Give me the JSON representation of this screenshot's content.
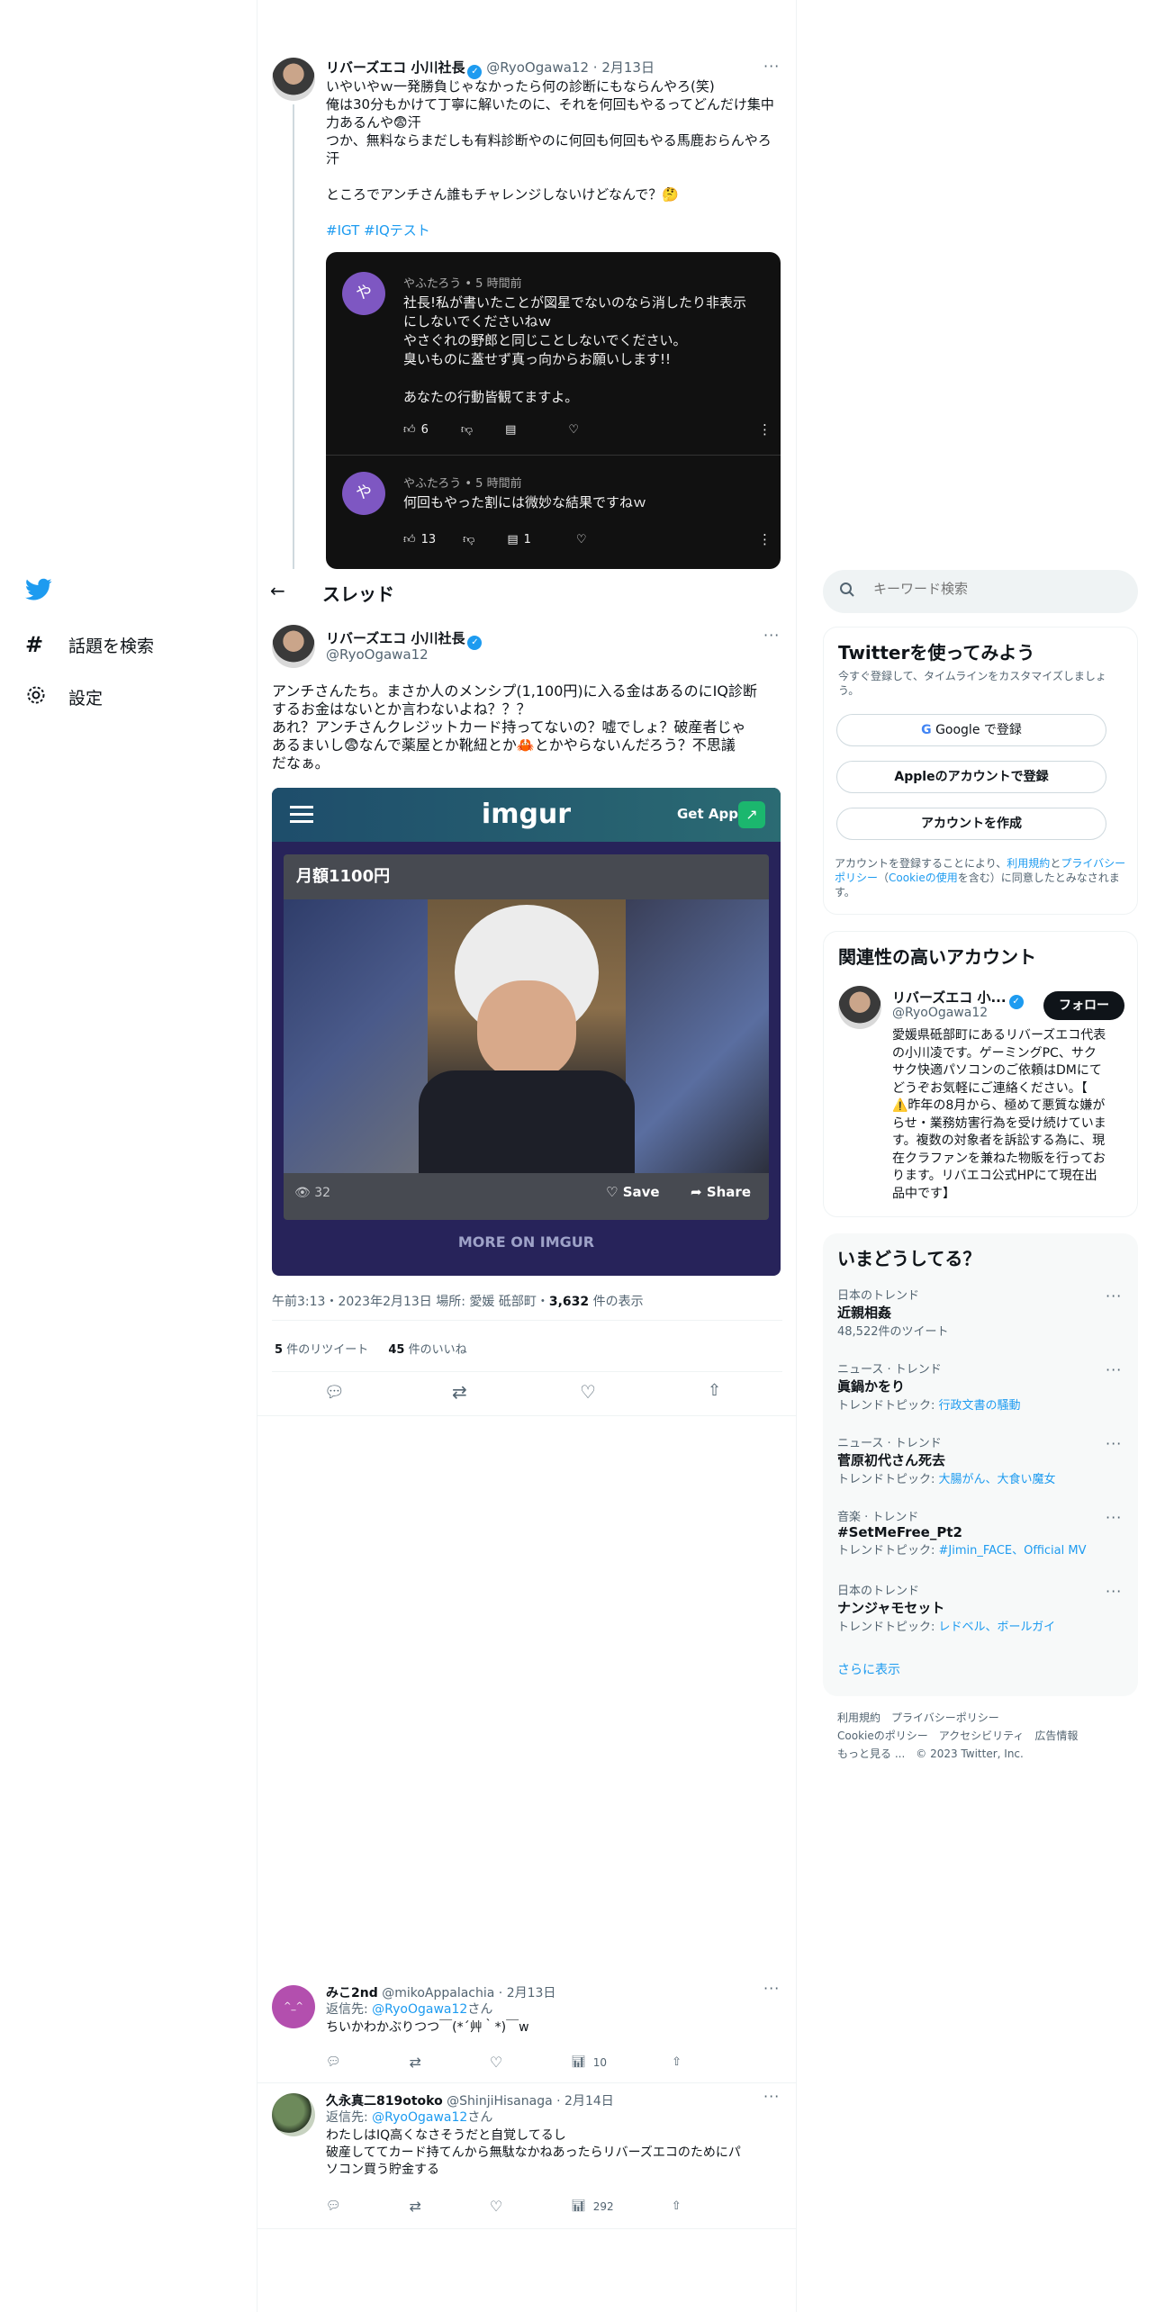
{
  "left_nav": {
    "items": [
      {
        "label": "話題を検索"
      },
      {
        "label": "設定"
      }
    ]
  },
  "quoted_tweet": {
    "name": "リバーズエコ 小川社長",
    "handle": "@RyoOgawa12",
    "date": "2月13日",
    "lines": [
      "いやいやｗ一発勝負じゃなかったら何の診断にもならんやろ(笑)",
      "俺は30分もかけて丁寧に解いたのに、それを何回もやるってどんだけ集中",
      "力あるんや😨汗",
      "つか、無料ならまだしも有料診断やのに何回も何回もやる馬鹿おらんやろ",
      "汗",
      "",
      "ところでアンチさん誰もチャレンジしないけどなんで？🤔"
    ],
    "hashtags": "#IGT #IQテスト",
    "embedded_comments": [
      {
        "avatar_char": "や",
        "author": "やふたろう",
        "time": "5 時間前",
        "lines": [
          "社長!私が書いたことが図星でないのなら消したり非表示",
          "にしないでくださいねｗ",
          "やさぐれの野郎と同じことしないでください。",
          "臭いものに蓋せず真っ向からお願いします!!",
          "",
          "あなたの行動皆観てますよ。"
        ],
        "likes": "6",
        "replies": ""
      },
      {
        "avatar_char": "や",
        "author": "やふたろう",
        "time": "5 時間前",
        "lines": [
          "何回もやった割には微妙な結果ですねｗ"
        ],
        "likes": "13",
        "replies": "1"
      }
    ]
  },
  "thread_header": {
    "title": "スレッド"
  },
  "main_tweet": {
    "name": "リバーズエコ 小川社長",
    "handle": "@RyoOgawa12",
    "lines": [
      "アンチさんたち。まさか人のメンシプ(1,100円)に入る金はあるのにIQ診断",
      "するお金はないとか言わないよね？？？",
      "あれ？アンチさんクレジットカード持ってないの？嘘でしょ？破産者じゃ",
      "あるまいし😨なんで薬屋とか靴紐とか🦀とかやらないんだろう？不思議",
      "だなぁ。"
    ],
    "imgur": {
      "logo": "imgur",
      "get_app": "Get App",
      "post_title": "月額1100円",
      "views": "32",
      "save": "Save",
      "share": "Share",
      "more": "MORE ON IMGUR"
    },
    "meta": "午前3:13・2023年2月13日 場所: 愛媛 砥部町・",
    "views_count": "3,632",
    "views_label": "件の表示",
    "retweets_count": "5",
    "retweets_label": "件のリツイート",
    "likes_count": "45",
    "likes_label": "件のいいね"
  },
  "replies": [
    {
      "name": "みこ2nd",
      "handle": "@mikoAppalachia",
      "date": "2月13日",
      "reply_prefix": "返信先: ",
      "reply_to": "@RyoOgawa12",
      "reply_suffix": "さん",
      "lines": [
        "ちいかわかぶりつつ￣(*´艸｀*)￣w"
      ],
      "views": "10"
    },
    {
      "name": "久永真二819otoko",
      "handle": "@ShinjiHisanaga",
      "date": "2月14日",
      "reply_prefix": "返信先: ",
      "reply_to": "@RyoOgawa12",
      "reply_suffix": "さん",
      "lines": [
        "わたしはIQ高くなさそうだと自覚してるし",
        "破産しててカード持てんから無駄なかねあったらリバーズエコのためにパ",
        "ソコン買う貯金する"
      ],
      "views": "292"
    }
  ],
  "search": {
    "placeholder": "キーワード検索"
  },
  "signup_panel": {
    "title": "Twitterを使ってみよう",
    "desc": "今すぐ登録して、タイムラインをカスタマイズしましょう。",
    "google": "Google で登録",
    "apple": "Appleのアカウントで登録",
    "create": "アカウントを作成",
    "legal_1": "アカウントを登録することにより、",
    "legal_terms": "利用規約",
    "legal_2": "と",
    "legal_privacy": "プライバシーポリシー",
    "legal_3": "（",
    "legal_cookie": "Cookieの使用",
    "legal_4": "を含む）に同意したとみなされます。"
  },
  "related_panel": {
    "title": "関連性の高いアカウント",
    "name": "リバーズエコ 小...",
    "handle": "@RyoOgawa12",
    "follow": "フォロー",
    "bio_lines": [
      "愛媛県砥部町にあるリバーズエコ代表",
      "の小川凌です。ゲーミングPC、サク",
      "サク快適パソコンのご依頼はDMにて",
      "どうぞお気軽にご連絡ください。【",
      "⚠️昨年の8月から、極めて悪質な嫌が",
      "らせ・業務妨害行為を受け続けていま",
      "す。複数の対象者を訴訟する為に、現",
      "在クラファンを兼ねた物販を行ってお",
      "ります。リバエコ公式HPにて現在出",
      "品中です】"
    ]
  },
  "trends_panel": {
    "title": "いまどうしてる？",
    "items": [
      {
        "category": "日本のトレンド",
        "name": "近親相姦",
        "sub": "48,522件のツイート",
        "sub_link": ""
      },
      {
        "category": "ニュース · トレンド",
        "name": "眞鍋かをり",
        "sub": "トレンドトピック: ",
        "sub_link": "行政文書の騒動"
      },
      {
        "category": "ニュース · トレンド",
        "name": "菅原初代さん死去",
        "sub": "トレンドトピック: ",
        "sub_link": "大腸がん、大食い魔女"
      },
      {
        "category": "音楽 · トレンド",
        "name": "#SetMeFree_Pt2",
        "sub": "トレンドトピック: ",
        "sub_link": "#Jimin_FACE、Official MV"
      },
      {
        "category": "日本のトレンド",
        "name": "ナンジャモセット",
        "sub": "トレンドトピック: ",
        "sub_link": "レドベル、ボールガイ"
      }
    ],
    "more": "さらに表示"
  },
  "footer": {
    "line1": "利用規約　プライバシーポリシー",
    "line2": "Cookieのポリシー　アクセシビリティ　広告情報",
    "line3": "もっと見る ...　© 2023 Twitter, Inc."
  },
  "colors": {
    "accent": "#1d9bf0",
    "imgur_bg": "#27235a",
    "dark_card": "#111111"
  }
}
